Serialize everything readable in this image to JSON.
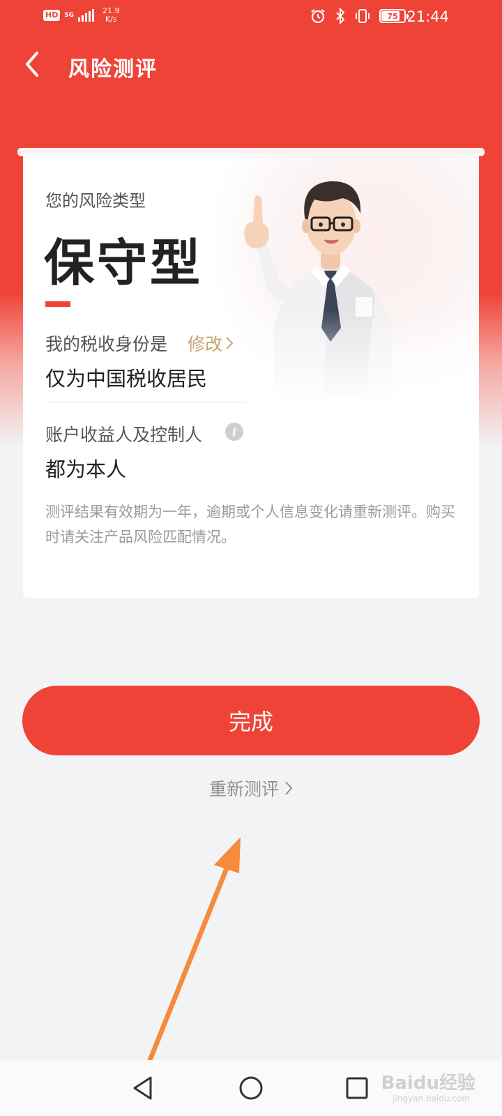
{
  "status_bar": {
    "hd": "HD",
    "network": "5G",
    "speed_value": "21.9",
    "speed_unit": "K/s",
    "battery": "75",
    "time": "21:44"
  },
  "header": {
    "title": "风险测评",
    "back_icon": "chevron-left-icon"
  },
  "card": {
    "risk_label": "您的风险类型",
    "risk_type": "保守型",
    "tax_label": "我的税收身份是",
    "edit_label": "修改",
    "tax_value": "仅为中国税收居民",
    "beneficiary_label": "账户收益人及控制人",
    "beneficiary_value": "都为本人",
    "notice": "测评结果有效期为一年，逾期或个人信息变化请重新测评。购买时请关注产品风险匹配情况。"
  },
  "actions": {
    "done_label": "完成",
    "retest_label": "重新测评"
  },
  "nav": {
    "back_icon": "triangle-back-icon",
    "home_icon": "circle-home-icon",
    "recent_icon": "square-recent-icon"
  },
  "watermark": {
    "brand": "Baidu经验",
    "url": "jingyan.baidu.com"
  },
  "colors": {
    "primary": "#ef4337",
    "accent_gold": "#c7a372",
    "annotation": "#f58b3c"
  }
}
